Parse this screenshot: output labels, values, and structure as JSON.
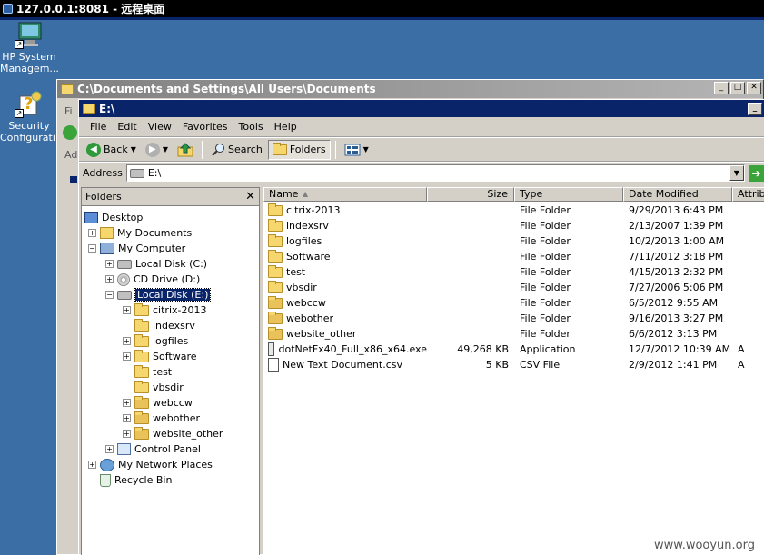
{
  "rdp": {
    "title": "127.0.0.1:8081 - 远程桌面"
  },
  "desktop_icons": [
    {
      "label": "HP System Managem...",
      "icon": "hp-sim-icon"
    },
    {
      "label": "Security Configurati...",
      "icon": "security-config-icon"
    }
  ],
  "back_window": {
    "title": "C:\\Documents and Settings\\All Users\\Documents",
    "frag1": "Fi",
    "frag2": "Ad"
  },
  "window": {
    "title": "E:\\"
  },
  "menu": [
    "File",
    "Edit",
    "View",
    "Favorites",
    "Tools",
    "Help"
  ],
  "toolbar": {
    "back": "Back",
    "search": "Search",
    "folders": "Folders"
  },
  "address": {
    "label": "Address",
    "value": "E:\\"
  },
  "folders_pane": {
    "title": "Folders"
  },
  "tree": [
    {
      "label": "Desktop",
      "icon": "desktop-icon",
      "level": 0,
      "expander": ""
    },
    {
      "label": "My Documents",
      "icon": "my-documents-icon",
      "level": 1,
      "expander": "+"
    },
    {
      "label": "My Computer",
      "icon": "my-computer-icon",
      "level": 1,
      "expander": "-"
    },
    {
      "label": "Local Disk (C:)",
      "icon": "drive-icon",
      "level": 2,
      "expander": "+"
    },
    {
      "label": "CD Drive (D:)",
      "icon": "cd-drive-icon",
      "level": 2,
      "expander": "+"
    },
    {
      "label": "Local Disk (E:)",
      "icon": "drive-icon",
      "level": 2,
      "expander": "-",
      "selected": true
    },
    {
      "label": "citrix-2013",
      "icon": "folder-icon",
      "level": 3,
      "expander": "+"
    },
    {
      "label": "indexsrv",
      "icon": "folder-icon",
      "level": 3,
      "expander": ""
    },
    {
      "label": "logfiles",
      "icon": "folder-icon",
      "level": 3,
      "expander": "+"
    },
    {
      "label": "Software",
      "icon": "folder-icon",
      "level": 3,
      "expander": "+"
    },
    {
      "label": "test",
      "icon": "folder-icon",
      "level": 3,
      "expander": ""
    },
    {
      "label": "vbsdir",
      "icon": "folder-icon",
      "level": 3,
      "expander": ""
    },
    {
      "label": "webccw",
      "icon": "web-folder-icon",
      "level": 3,
      "expander": "+"
    },
    {
      "label": "webother",
      "icon": "web-folder-icon",
      "level": 3,
      "expander": "+"
    },
    {
      "label": "website_other",
      "icon": "web-folder-icon",
      "level": 3,
      "expander": "+"
    },
    {
      "label": "Control Panel",
      "icon": "control-panel-icon",
      "level": 2,
      "expander": "+"
    },
    {
      "label": "My Network Places",
      "icon": "network-places-icon",
      "level": 1,
      "expander": "+"
    },
    {
      "label": "Recycle Bin",
      "icon": "recycle-bin-icon",
      "level": 1,
      "expander": ""
    }
  ],
  "columns": [
    "Name",
    "Size",
    "Type",
    "Date Modified",
    "Attribu"
  ],
  "files": [
    {
      "name": "citrix-2013",
      "size": "",
      "type": "File Folder",
      "date": "9/29/2013 6:43 PM",
      "attr": "",
      "icon": "folder-icon"
    },
    {
      "name": "indexsrv",
      "size": "",
      "type": "File Folder",
      "date": "2/13/2007 1:39 PM",
      "attr": "",
      "icon": "folder-icon"
    },
    {
      "name": "logfiles",
      "size": "",
      "type": "File Folder",
      "date": "10/2/2013 1:00 AM",
      "attr": "",
      "icon": "folder-icon"
    },
    {
      "name": "Software",
      "size": "",
      "type": "File Folder",
      "date": "7/11/2012 3:18 PM",
      "attr": "",
      "icon": "folder-icon"
    },
    {
      "name": "test",
      "size": "",
      "type": "File Folder",
      "date": "4/15/2013 2:32 PM",
      "attr": "",
      "icon": "folder-icon"
    },
    {
      "name": "vbsdir",
      "size": "",
      "type": "File Folder",
      "date": "7/27/2006 5:06 PM",
      "attr": "",
      "icon": "folder-icon"
    },
    {
      "name": "webccw",
      "size": "",
      "type": "File Folder",
      "date": "6/5/2012 9:55 AM",
      "attr": "",
      "icon": "web-folder-icon"
    },
    {
      "name": "webother",
      "size": "",
      "type": "File Folder",
      "date": "9/16/2013 3:27 PM",
      "attr": "",
      "icon": "web-folder-icon"
    },
    {
      "name": "website_other",
      "size": "",
      "type": "File Folder",
      "date": "6/6/2012 3:13 PM",
      "attr": "",
      "icon": "web-folder-icon"
    },
    {
      "name": "dotNetFx40_Full_x86_x64.exe",
      "size": "49,268 KB",
      "type": "Application",
      "date": "12/7/2012 10:39 AM",
      "attr": "A",
      "icon": "exe-icon"
    },
    {
      "name": "New Text Document.csv",
      "size": "5 KB",
      "type": "CSV File",
      "date": "2/9/2012 1:41 PM",
      "attr": "A",
      "icon": "csv-file-icon"
    }
  ],
  "watermark": "www.wooyun.org"
}
